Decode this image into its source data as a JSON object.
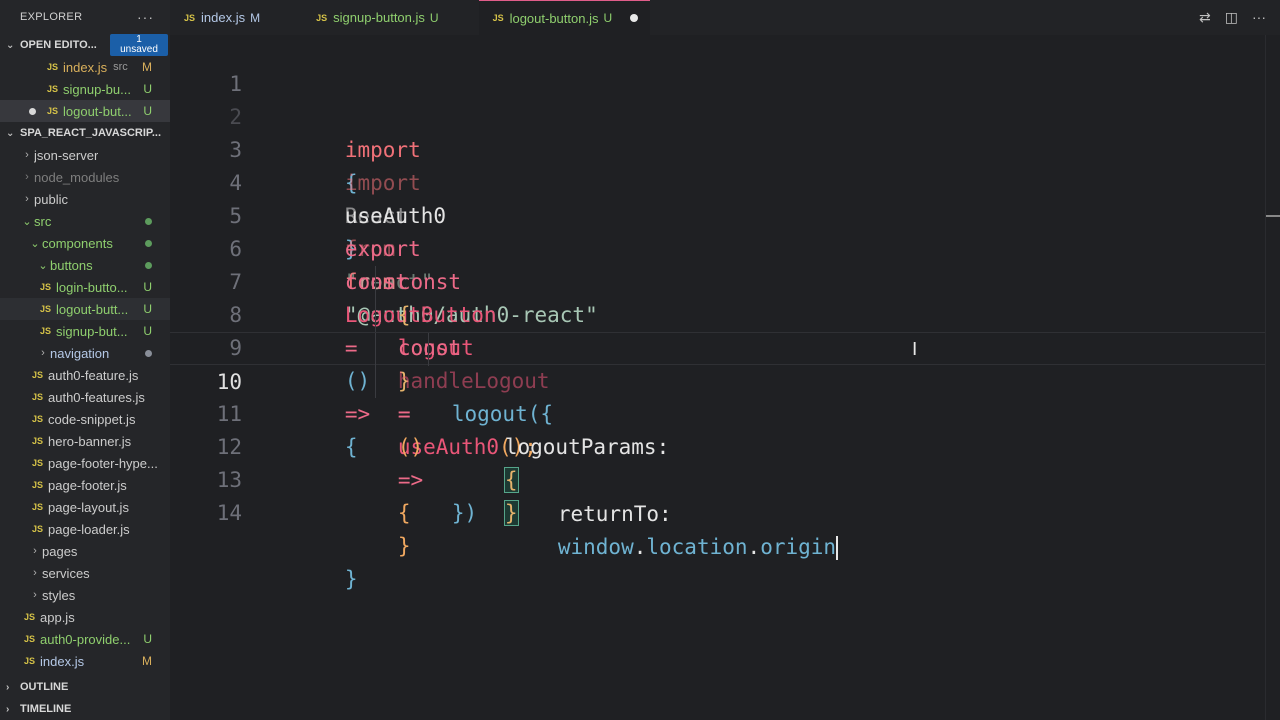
{
  "sidebar": {
    "title": "EXPLORER",
    "more": "···",
    "open_editors": {
      "label": "OPEN EDITO...",
      "unsaved_count": "1",
      "unsaved_label": "unsaved",
      "items": [
        {
          "name": "index.js",
          "sub": "src",
          "status": "M"
        },
        {
          "name": "signup-bu...",
          "status": "U"
        },
        {
          "name": "logout-but...",
          "status": "U"
        }
      ]
    },
    "project": {
      "label": "SPA_REACT_JAVASCRIP...",
      "items": [
        {
          "name": "json-server"
        },
        {
          "name": "node_modules"
        },
        {
          "name": "public"
        },
        {
          "name": "src"
        },
        {
          "name": "components"
        },
        {
          "name": "buttons"
        },
        {
          "name": "login-butto...",
          "status": "U"
        },
        {
          "name": "logout-butt...",
          "status": "U"
        },
        {
          "name": "signup-but...",
          "status": "U"
        },
        {
          "name": "navigation"
        },
        {
          "name": "auth0-feature.js"
        },
        {
          "name": "auth0-features.js"
        },
        {
          "name": "code-snippet.js"
        },
        {
          "name": "hero-banner.js"
        },
        {
          "name": "page-footer-hype..."
        },
        {
          "name": "page-footer.js"
        },
        {
          "name": "page-layout.js"
        },
        {
          "name": "page-loader.js"
        },
        {
          "name": "pages"
        },
        {
          "name": "services"
        },
        {
          "name": "styles"
        },
        {
          "name": "app.js"
        },
        {
          "name": "auth0-provide...",
          "status": "U"
        },
        {
          "name": "index.js",
          "status": "M"
        }
      ]
    },
    "outline": "OUTLINE",
    "timeline": "TIMELINE"
  },
  "tabs": [
    {
      "name": "index.js",
      "status": "M"
    },
    {
      "name": "signup-button.js",
      "status": "U"
    },
    {
      "name": "logout-button.js",
      "status": "U"
    }
  ],
  "editor": {
    "line_numbers": [
      "1",
      "2",
      "3",
      "4",
      "5",
      "6",
      "7",
      "8",
      "9",
      "10",
      "11",
      "12",
      "13",
      "14"
    ],
    "code": {
      "l1_import": "import",
      "l1_open": "{",
      "l1_name": "useAuth0",
      "l1_close": "}",
      "l1_from": "from",
      "l1_str": "\"@auth0/auth0-react\"",
      "l2_import": "import",
      "l2_name": "React",
      "l2_from": "from",
      "l2_str": "\"react\"",
      "l4_export": "export",
      "l4_const": "const",
      "l4_name": "LogoutButton",
      "l4_eq": "=",
      "l4_parens": "()",
      "l4_arrow": "=>",
      "l4_brace": "{",
      "l5_const": "const",
      "l5_open": "{",
      "l5_name": "logout",
      "l5_close": "}",
      "l5_eq": "=",
      "l5_fn": "useAuth0",
      "l5_call": "();",
      "l7_const": "const",
      "l7_name": "handleLogout",
      "l7_eq": "=",
      "l7_parens": "()",
      "l7_arrow": "=>",
      "l7_brace": "{",
      "l8_fn": "logout",
      "l8_paren": "(",
      "l8_brace": "{",
      "l9_key": "logoutParams:",
      "l9_brace": "{",
      "l10_key": "returnTo:",
      "l10_obj": "window",
      "l10_dot1": ".",
      "l10_prop1": "location",
      "l10_dot2": ".",
      "l10_prop2": "origin",
      "l11_brace": "}",
      "l12_brace": "}",
      "l12_paren": ")",
      "l13_brace": "}",
      "l14_brace": "}"
    }
  }
}
